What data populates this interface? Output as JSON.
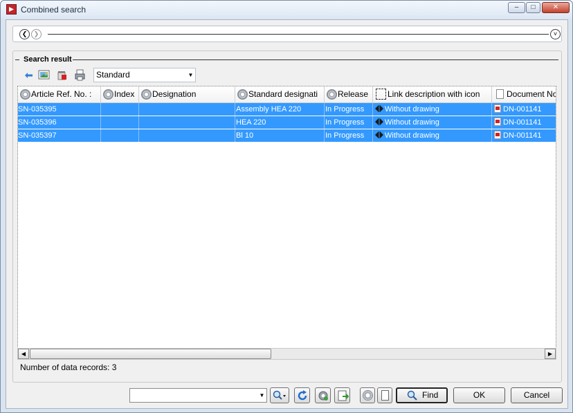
{
  "window": {
    "title": "Combined search",
    "controls": [
      "minimize",
      "maximize",
      "close"
    ]
  },
  "navigation": {
    "back_icon": "back-arrow-icon",
    "forward_icon": "forward-arrow-icon",
    "expand_icon": "chevron-down-icon"
  },
  "search_result": {
    "group_title": "Search result",
    "toolbar": {
      "icons": [
        "refresh-icon",
        "image-icon",
        "delete-icon",
        "print-icon"
      ],
      "view_select": "Standard"
    },
    "columns": [
      "Article Ref. No. :",
      "Index",
      "Designation",
      "Standard designati",
      "Release",
      "Link description with icon",
      "Document No"
    ],
    "rows": [
      {
        "article_ref": "SN-035395",
        "index": "",
        "designation": "",
        "standard_designation": "Assembly HEA 220",
        "release": "In Progress",
        "link_description": "Without drawing",
        "document_no": "DN-001141"
      },
      {
        "article_ref": "SN-035396",
        "index": "",
        "designation": "",
        "standard_designation": "HEA 220",
        "release": "In Progress",
        "link_description": "Without drawing",
        "document_no": "DN-001141"
      },
      {
        "article_ref": "SN-035397",
        "index": "",
        "designation": "",
        "standard_designation": "Bl 10",
        "release": "In Progress",
        "link_description": "Without drawing",
        "document_no": "DN-001141"
      }
    ],
    "selected_row_color": "#3399ff",
    "status_text": "Number of data records: 3"
  },
  "footer": {
    "combo_value": "",
    "icon_buttons": [
      "search-options-icon",
      "refresh-icon",
      "settings-icon",
      "export-icon",
      "gear-icon",
      "document-icon"
    ],
    "find_label": "Find",
    "ok_label": "OK",
    "cancel_label": "Cancel"
  }
}
